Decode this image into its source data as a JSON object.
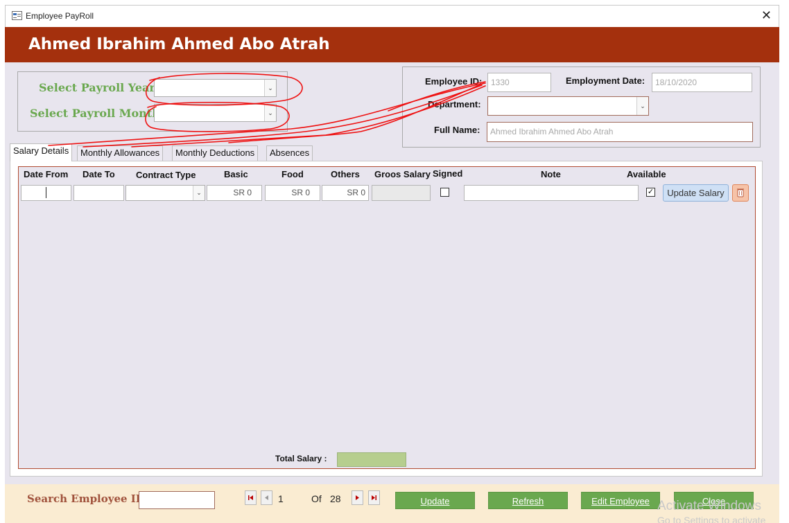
{
  "window": {
    "title": "Employee PayRoll",
    "close_glyph": "✕"
  },
  "header": {
    "employee_name": "Ahmed Ibrahim Ahmed Abo Atrah"
  },
  "payroll_select": {
    "year_label": "Select Payroll Year",
    "month_label": "Select Payroll Month:",
    "year_value": "",
    "month_value": ""
  },
  "employee": {
    "id_label": "Employee ID:",
    "id_value": "1330",
    "employment_date_label": "Employment Date:",
    "employment_date_value": "18/10/2020",
    "department_label": "Department:",
    "department_value": "",
    "full_name_label": "Full Name:",
    "full_name_value": "Ahmed Ibrahim Ahmed Abo Atrah"
  },
  "tabs": [
    {
      "label": "Salary Details",
      "active": true
    },
    {
      "label": "Monthly Allowances",
      "active": false
    },
    {
      "label": "Monthly Deductions",
      "active": false
    },
    {
      "label": "Absences",
      "active": false
    }
  ],
  "salary_table": {
    "headers": [
      "Date From",
      "Date To",
      "Contract Type",
      "Basic",
      "Food",
      "Others",
      "Groos Salary",
      "Signed",
      "Note",
      "Available"
    ],
    "row": {
      "date_from": "",
      "date_to": "",
      "contract_type": "",
      "basic": "SR 0",
      "food": "SR 0",
      "others": "SR 0",
      "gross_salary": "",
      "signed": false,
      "note": "",
      "available": true
    },
    "update_salary_label": "Update Salary",
    "delete_icon": "trash-icon"
  },
  "total": {
    "label": "Total Salary :",
    "value": ""
  },
  "footer": {
    "search_label": "Search Employee ID",
    "search_value": "",
    "record_current": "1",
    "record_of_label": "Of",
    "record_total": "28",
    "buttons": [
      "Update",
      "Refresh",
      "Edit Employee",
      "Close"
    ]
  },
  "os_watermark": {
    "line1": "Activate Windows",
    "line2": "Go to Settings to activate Windows."
  },
  "colors": {
    "header_bg": "#a4300d",
    "label_green": "#6aa84f",
    "button_green": "#6aa84f",
    "footer_bg": "#faecd2",
    "form_bg": "#e8e5ee",
    "total_box": "#b6ce8e",
    "annotation_red": "#ee1111"
  }
}
